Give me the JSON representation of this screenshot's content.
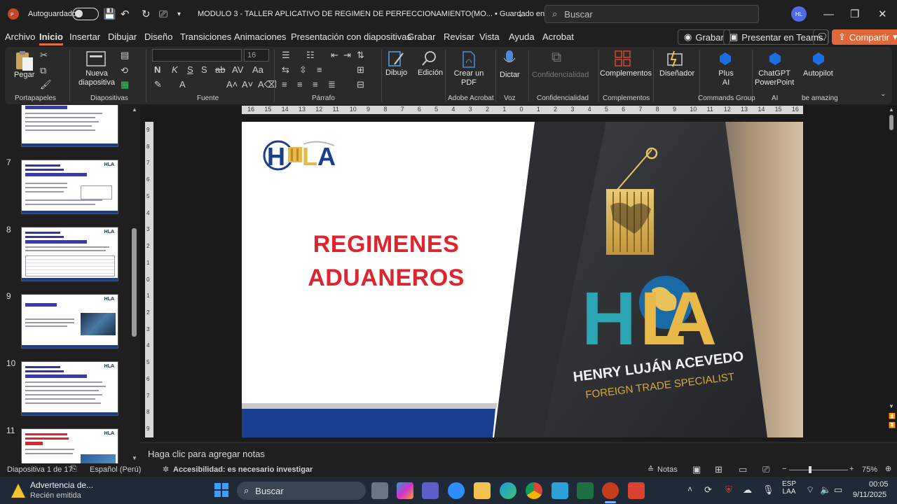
{
  "titlebar": {
    "autosave_label": "Autoguardado",
    "document_title": "MODULO 3 - TALLER APLICATIVO DE REGIMEN DE PERFECCIONAMIENTO(MO... • Guardado en Este PC",
    "search_placeholder": "Buscar",
    "user_initials": "HL"
  },
  "menu": {
    "items": [
      "Archivo",
      "Inicio",
      "Insertar",
      "Dibujar",
      "Diseño",
      "Transiciones",
      "Animaciones",
      "Presentación con diapositivas",
      "Grabar",
      "Revisar",
      "Vista",
      "Ayuda",
      "Acrobat"
    ],
    "record_label": "Grabar",
    "teams_label": "Presentar en Teams",
    "share_label": "Compartir"
  },
  "ribbon": {
    "paste_label": "Pegar",
    "new_slide_label": "Nueva diapositiva",
    "font_size": "16",
    "draw_label": "Dibujo",
    "edit_label": "Edición",
    "create_pdf_label": "Crear un PDF",
    "dictate_label": "Dictar",
    "confidentiality_label": "Confidencialidad",
    "addins_label": "Complementos",
    "designer_label": "Diseñador",
    "plus_ai_label": "Plus AI",
    "chatgpt_label": "ChatGPT PowerPoint",
    "autopilot_label": "Autopilot",
    "groups": {
      "clipboard": "Portapapeles",
      "slides": "Diapositivas",
      "font": "Fuente",
      "paragraph": "Párrafo",
      "adobe": "Adobe Acrobat",
      "voice": "Voz",
      "confidentiality": "Confidencialidad",
      "addins": "Complementos",
      "commands": "Commands Group",
      "ai": "AI",
      "be_amazing": "be amazing"
    }
  },
  "thumbnails": {
    "numbers": [
      "7",
      "8",
      "9",
      "10",
      "11"
    ]
  },
  "ruler_h_labels": [
    "16",
    "15",
    "14",
    "13",
    "12",
    "11",
    "10",
    "9",
    "8",
    "7",
    "6",
    "5",
    "4",
    "3",
    "2",
    "1",
    "0",
    "1",
    "2",
    "3",
    "4",
    "5",
    "6",
    "7",
    "8",
    "9",
    "10",
    "11",
    "12",
    "13",
    "14",
    "15",
    "16"
  ],
  "ruler_v_labels": [
    "9",
    "8",
    "7",
    "6",
    "5",
    "4",
    "3",
    "2",
    "1",
    "0",
    "1",
    "2",
    "3",
    "4",
    "5",
    "6",
    "7",
    "8",
    "9"
  ],
  "slide": {
    "title_line1": "REGIMENES",
    "title_line2": "ADUANEROS",
    "title_color": "#e0242d",
    "brand_name": "HENRY LUJÁN ACEVEDO",
    "brand_tagline": "FOREIGN TRADE SPECIALIST"
  },
  "notes_placeholder": "Haga clic para agregar notas",
  "status": {
    "slide_info": "Diapositiva 1 de 17",
    "language": "Español (Perú)",
    "accessibility": "Accesibilidad: es necesario investigar",
    "notes_label": "Notas",
    "zoom": "75%"
  },
  "taskbar": {
    "notification_title": "Advertencia de...",
    "notification_subtitle": "Recién emitida",
    "search_placeholder": "Buscar",
    "lang_line1": "ESP",
    "lang_line2": "LAA",
    "time": "00:05",
    "date": "9/11/2025"
  }
}
